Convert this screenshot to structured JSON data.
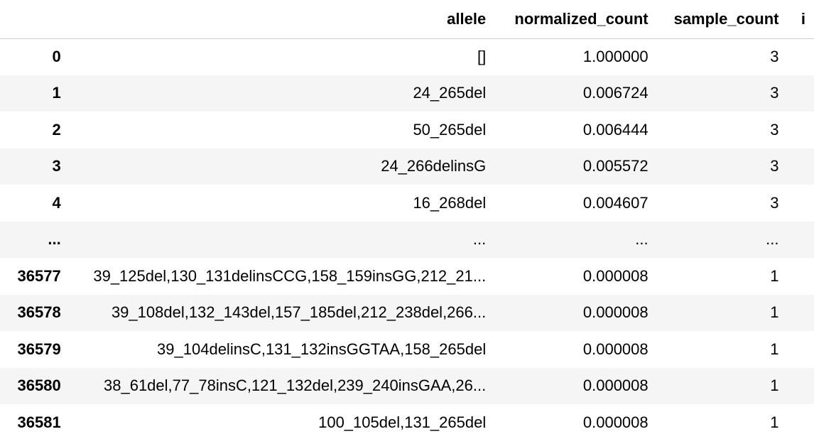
{
  "table": {
    "columns": [
      "",
      "allele",
      "normalized_count",
      "sample_count",
      "i"
    ],
    "rows": [
      {
        "index": "0",
        "allele": "[]",
        "normalized_count": "1.000000",
        "sample_count": "3"
      },
      {
        "index": "1",
        "allele": "24_265del",
        "normalized_count": "0.006724",
        "sample_count": "3"
      },
      {
        "index": "2",
        "allele": "50_265del",
        "normalized_count": "0.006444",
        "sample_count": "3"
      },
      {
        "index": "3",
        "allele": "24_266delinsG",
        "normalized_count": "0.005572",
        "sample_count": "3"
      },
      {
        "index": "4",
        "allele": "16_268del",
        "normalized_count": "0.004607",
        "sample_count": "3"
      },
      {
        "index": "...",
        "allele": "...",
        "normalized_count": "...",
        "sample_count": "..."
      },
      {
        "index": "36577",
        "allele": "39_125del,130_131delinsCCG,158_159insGG,212_21...",
        "normalized_count": "0.000008",
        "sample_count": "1"
      },
      {
        "index": "36578",
        "allele": "39_108del,132_143del,157_185del,212_238del,266...",
        "normalized_count": "0.000008",
        "sample_count": "1"
      },
      {
        "index": "36579",
        "allele": "39_104delinsC,131_132insGGTAA,158_265del",
        "normalized_count": "0.000008",
        "sample_count": "1"
      },
      {
        "index": "36580",
        "allele": "38_61del,77_78insC,121_132del,239_240insGAA,26...",
        "normalized_count": "0.000008",
        "sample_count": "1"
      },
      {
        "index": "36581",
        "allele": "100_105del,131_265del",
        "normalized_count": "0.000008",
        "sample_count": "1"
      }
    ]
  }
}
